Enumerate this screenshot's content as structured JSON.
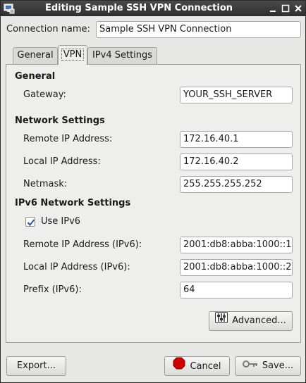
{
  "window": {
    "title": "Editing Sample SSH VPN Connection",
    "icons": {
      "app": "network-connection-icon",
      "minimize": "minimize-icon",
      "maximize": "maximize-icon",
      "close": "close-icon"
    }
  },
  "connection": {
    "name_label": "Connection name:",
    "name_value": "Sample SSH VPN Connection"
  },
  "tabs": [
    {
      "label": "General",
      "selected": false
    },
    {
      "label": "VPN",
      "selected": true
    },
    {
      "label": "IPv4 Settings",
      "selected": false
    }
  ],
  "vpn": {
    "general": {
      "heading": "General",
      "gateway_label": "Gateway:",
      "gateway_value": "YOUR_SSH_SERVER"
    },
    "network": {
      "heading": "Network Settings",
      "remote_ip_label": "Remote IP Address:",
      "remote_ip_value": "172.16.40.1",
      "local_ip_label": "Local IP Address:",
      "local_ip_value": "172.16.40.2",
      "netmask_label": "Netmask:",
      "netmask_value": "255.255.255.252"
    },
    "ipv6": {
      "heading": "IPv6 Network Settings",
      "use_ipv6_label": "Use IPv6",
      "use_ipv6_checked": true,
      "remote_ip_label": "Remote IP Address (IPv6):",
      "remote_ip_value": "2001:db8:abba:1000::1",
      "local_ip_label": "Local IP Address (IPv6):",
      "local_ip_value": "2001:db8:abba:1000::2",
      "prefix_label": "Prefix (IPv6):",
      "prefix_value": "64"
    },
    "advanced_label": "Advanced..."
  },
  "buttons": {
    "export_label": "Export...",
    "cancel_label": "Cancel",
    "save_label": "Save..."
  },
  "colors": {
    "titlebar": "#2e2e2e",
    "window_bg": "#e8e8e7",
    "cancel_icon": "#cc0000",
    "check_mark": "#3465a4"
  }
}
